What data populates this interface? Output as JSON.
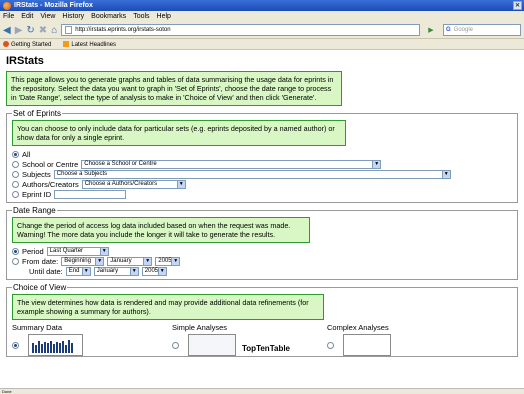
{
  "window": {
    "title": "IRStats - Mozilla Firefox"
  },
  "menu": [
    "File",
    "Edit",
    "View",
    "History",
    "Bookmarks",
    "Tools",
    "Help"
  ],
  "nav": {
    "url": "http://irstats.eprints.org/irstats-soton",
    "search_placeholder": "Google"
  },
  "bookmarks": [
    "Getting Started",
    "Latest Headlines"
  ],
  "page": {
    "title": "IRStats",
    "intro": "This page allows you to generate graphs and tables of data summarising the usage data for eprints in the repository. Select the data you want to graph in 'Set of Eprints', choose the date range to process in 'Date Range', select the type of analysis to make in 'Choice of View' and then click 'Generate'."
  },
  "set_of_eprints": {
    "legend": "Set of Eprints",
    "info": "You can choose to only include data for particular sets (e.g. eprints deposited by a named author) or show data for only a single eprint.",
    "options": {
      "all": "All",
      "school": "School or Centre",
      "school_select": "Choose a School or Centre",
      "subjects": "Subjects",
      "subjects_select": "Choose a Subjects",
      "authors": "Authors/Creators",
      "authors_select": "Choose a Authors/Creators",
      "eprint_id": "Eprint ID"
    }
  },
  "date_range": {
    "legend": "Date Range",
    "info": "Change the period of access log data included based on when the request was made. Warning! The more data you include the longer it will take to generate the results.",
    "period_label": "Period",
    "period_value": "Last Quarter",
    "from_label": "From date:",
    "from_values": [
      "Beginning",
      "January",
      "2005"
    ],
    "until_label": "Until date:",
    "until_values": [
      "End",
      "January",
      "2005"
    ]
  },
  "choice_of_view": {
    "legend": "Choice of View",
    "info": "The view determines how data is rendered and may provide additional data refinements (for example showing a summary for authors).",
    "summary": "Summary Data",
    "simple": "Simple Analyses",
    "complex": "Complex Analyses",
    "top_ten": "TopTenTable"
  },
  "status": {
    "text": "Done"
  }
}
